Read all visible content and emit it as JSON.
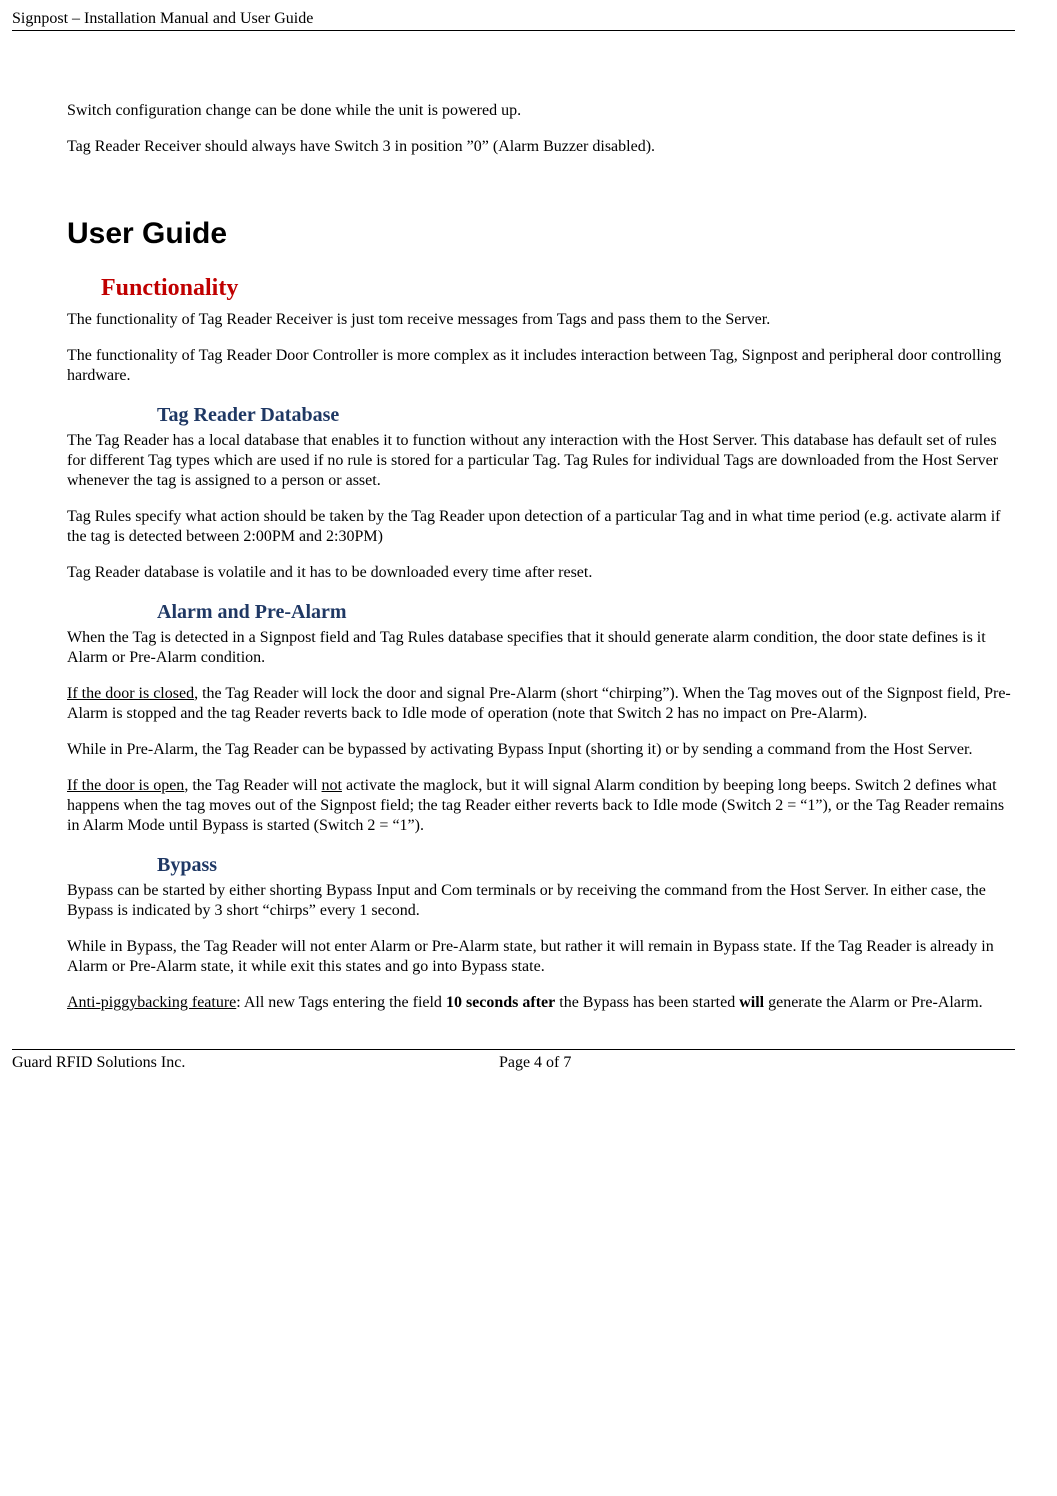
{
  "header": {
    "title": "Signpost – Installation Manual and User Guide"
  },
  "intro": {
    "p1": "Switch configuration change can be done while the unit is powered up.",
    "p2": "Tag Reader Receiver should always have Switch 3 in position ”0” (Alarm Buzzer disabled)."
  },
  "h1": "User Guide",
  "functionality": {
    "heading": "Functionality",
    "p1": "The functionality of Tag Reader Receiver is just tom receive messages from Tags and pass them to the Server.",
    "p2": "The functionality of Tag Reader Door Controller is more complex as it includes interaction between Tag, Signpost and peripheral door controlling hardware."
  },
  "database": {
    "heading": "Tag Reader Database",
    "p1": "The Tag Reader has a local database that enables it to function without any interaction with the Host Server. This database has default set of rules for different Tag types which are used if no rule is stored for a particular Tag. Tag Rules for individual Tags are downloaded from the Host Server whenever the tag is assigned to a person or asset.",
    "p2": "Tag Rules specify what action should be taken by the Tag Reader upon detection of a particular Tag and in what time period (e.g. activate alarm if the tag is detected between 2:00PM and 2:30PM)",
    "p3": "Tag Reader database is volatile and it has to be downloaded every time after reset."
  },
  "alarm": {
    "heading": "Alarm and Pre-Alarm",
    "p1": "When the Tag is detected in a Signpost field and Tag Rules database specifies that it should generate alarm condition, the door state defines is it Alarm or Pre-Alarm condition.",
    "p2_lead": "If the door is closed",
    "p2_rest": ", the Tag Reader will lock the door and signal Pre-Alarm (short “chirping”). When the Tag moves out of the Signpost field, Pre-Alarm is stopped and the tag Reader reverts back to Idle mode of operation (note that Switch 2 has no impact on Pre-Alarm).",
    "p3": "While in Pre-Alarm, the Tag Reader can be bypassed by activating Bypass Input (shorting it) or by sending a command from the Host Server.",
    "p4_lead": "If the door is open",
    "p4_mid1": ", the Tag Reader will ",
    "p4_not": "not",
    "p4_rest": " activate the maglock, but it will signal Alarm condition by beeping long beeps. Switch 2 defines what happens when the tag moves out of the Signpost field; the tag Reader either reverts back to Idle mode (Switch 2 = “1”), or the Tag Reader remains in Alarm Mode until Bypass is started (Switch 2 = “1”)."
  },
  "bypass": {
    "heading": "Bypass",
    "p1": "Bypass can be started by either shorting Bypass Input and Com terminals or by receiving the command from the Host Server. In either case, the Bypass is indicated by 3 short “chirps” every 1 second.",
    "p2": "While in Bypass, the Tag Reader will not enter Alarm or Pre-Alarm state, but rather it will remain in Bypass state. If the Tag Reader is already in Alarm or Pre-Alarm state, it while exit this states and go into Bypass state.",
    "p3_lead": "Anti-piggybacking feature",
    "p3_mid1": ": All new Tags entering the field ",
    "p3_bold": "10 seconds after",
    "p3_mid2": " the Bypass has been started ",
    "p3_will": "will",
    "p3_rest": " generate the Alarm or Pre-Alarm."
  },
  "footer": {
    "left": "Guard RFID Solutions Inc.",
    "center": "Page 4 of 7"
  }
}
